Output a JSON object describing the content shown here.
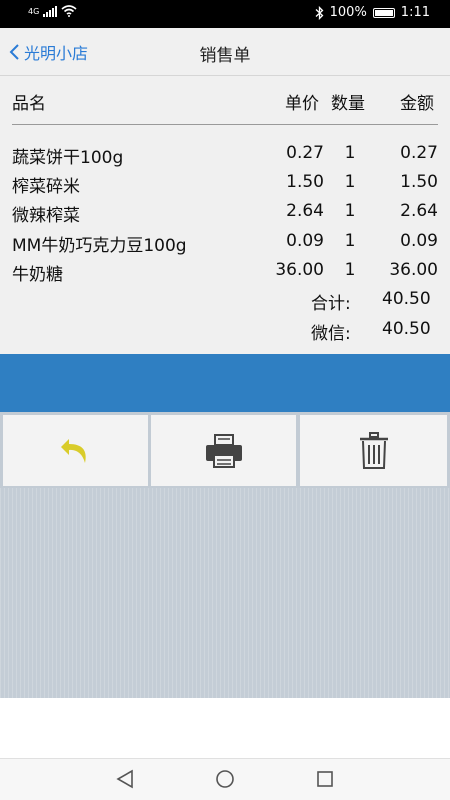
{
  "status": {
    "network": "4G",
    "battery": "100%",
    "time": "1:11"
  },
  "nav": {
    "back_label": "光明小店",
    "title": "销售单"
  },
  "table": {
    "headers": {
      "name": "品名",
      "price": "单价",
      "qty": "数量",
      "amount": "金额"
    },
    "rows": [
      {
        "name": "蔬菜饼干100g",
        "price": "0.27",
        "qty": "1",
        "amount": "0.27"
      },
      {
        "name": "榨菜碎米",
        "price": "1.50",
        "qty": "1",
        "amount": "1.50"
      },
      {
        "name": "微辣榨菜",
        "price": "2.64",
        "qty": "1",
        "amount": "2.64"
      },
      {
        "name": "MM牛奶巧克力豆100g",
        "price": "0.09",
        "qty": "1",
        "amount": "0.09"
      },
      {
        "name": "牛奶糖",
        "price": "36.00",
        "qty": "1",
        "amount": "36.00"
      }
    ]
  },
  "summary": {
    "total_label": "合计:",
    "total": "40.50",
    "wechat_label": "微信:",
    "wechat": "40.50"
  },
  "colors": {
    "accent": "#2a7bd6",
    "bar": "#2f7fc2",
    "undo_icon": "#d9cc2a"
  },
  "actions": {
    "undo_icon": "undo-arrow",
    "print_icon": "printer",
    "delete_icon": "trash-can"
  }
}
